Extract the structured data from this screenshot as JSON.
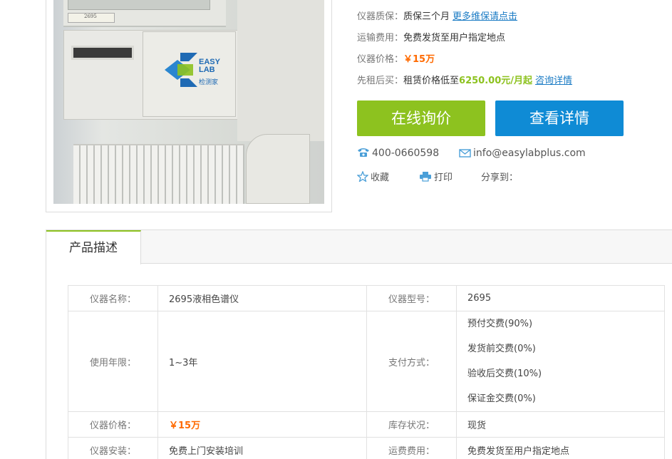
{
  "product_image": {
    "label_text": "2695",
    "watermark": {
      "brand": "EASY LAB",
      "brand_line1": "EASY",
      "brand_line2": "LAB",
      "cn": "检测家"
    }
  },
  "info": {
    "warranty": {
      "label": "仪器质保：",
      "value": "质保三个月",
      "link": "更多维保请点击"
    },
    "shipping": {
      "label": "运输费用：",
      "value": "免费发货至用户指定地点"
    },
    "price": {
      "label": "仪器价格：",
      "value": "￥15万"
    },
    "rent": {
      "label": "先租后买：",
      "prefix": "租赁价格低至",
      "value": "6250.00元/月起",
      "link": "咨询详情"
    }
  },
  "buttons": {
    "inquiry": "在线询价",
    "details": "查看详情"
  },
  "contact": {
    "phone": "400-0660598",
    "email": "info@easylabplus.com"
  },
  "tools": {
    "favorite": "收藏",
    "print": "打印",
    "share": "分享到："
  },
  "tabs": {
    "description": "产品描述"
  },
  "spec": {
    "name_label": "仪器名称：",
    "name_value": "2695液相色谱仪",
    "model_label": "仪器型号：",
    "model_value": "2695",
    "years_label": "使用年限：",
    "years_value": "1~3年",
    "payment_label": "支付方式：",
    "payment_options": [
      "预付交费(90%)",
      "发货前交费(0%)",
      "验收后交费(10%)",
      "保证金交费(0%)"
    ],
    "price_label": "仪器价格：",
    "price_value": "￥15万",
    "stock_label": "库存状况：",
    "stock_value": "现货",
    "install_label": "仪器安装：",
    "install_value": "免费上门安装培训",
    "freight_label": "运费费用：",
    "freight_value": "免费发货至用户指定地点"
  },
  "colors": {
    "accent_green": "#8dc21f",
    "accent_blue": "#0f8bd5",
    "price_orange": "#ff6a00",
    "link_blue": "#1a7bc4"
  }
}
